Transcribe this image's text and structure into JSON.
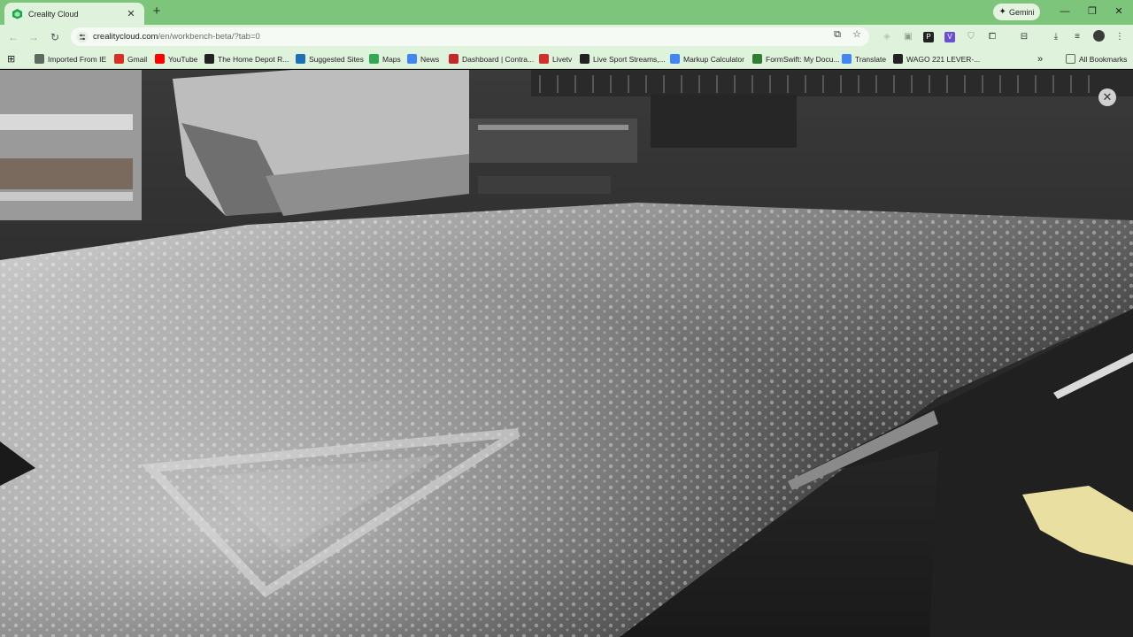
{
  "tab": {
    "title": "Creality Cloud",
    "close": "✕"
  },
  "new_tab_label": "+",
  "gemini_label": "Gemini",
  "window_controls": {
    "minimize": "—",
    "restore": "❐",
    "close": "✕"
  },
  "nav": {
    "back": "←",
    "forward": "→",
    "reload": "↻"
  },
  "address": {
    "domain": "crealitycloud.com",
    "path": "/en/workbench-beta/?tab=0"
  },
  "bookmarks": [
    {
      "label": "Imported From IE",
      "icon": "folder-icon",
      "color": "#5f6b5f"
    },
    {
      "label": "Gmail",
      "icon": "gmail-icon",
      "color": "#d93025"
    },
    {
      "label": "YouTube",
      "icon": "youtube-icon",
      "color": "#ff0000"
    },
    {
      "label": "The Home Depot R...",
      "icon": "home-depot-icon",
      "color": "#222222"
    },
    {
      "label": "Suggested Sites",
      "icon": "bing-icon",
      "color": "#1d6fb8"
    },
    {
      "label": "Maps",
      "icon": "maps-icon",
      "color": "#34a853"
    },
    {
      "label": "News",
      "icon": "news-icon",
      "color": "#4285f4"
    },
    {
      "label": "Dashboard | Contra...",
      "icon": "dashboard-icon",
      "color": "#c62828"
    },
    {
      "label": "Livetv",
      "icon": "livetv-icon",
      "color": "#d32f2f"
    },
    {
      "label": "Live Sport Streams,...",
      "icon": "sport-icon",
      "color": "#222222"
    },
    {
      "label": "Markup Calculator",
      "icon": "google-icon",
      "color": "#4285f4"
    },
    {
      "label": "FormSwift: My Docu...",
      "icon": "formswift-icon",
      "color": "#2e7d32"
    },
    {
      "label": "Translate",
      "icon": "translate-icon",
      "color": "#4285f4"
    },
    {
      "label": "WAGO 221 LEVER-...",
      "icon": "amazon-icon",
      "color": "#222222"
    }
  ],
  "overflow_label": "»",
  "all_bookmarks_label": "All Bookmarks",
  "feed_close": "✕",
  "colors": {
    "tabstrip": "#7dc57a",
    "toolbar": "#dff2dc",
    "accent_yellow": "#e9dfa0"
  }
}
